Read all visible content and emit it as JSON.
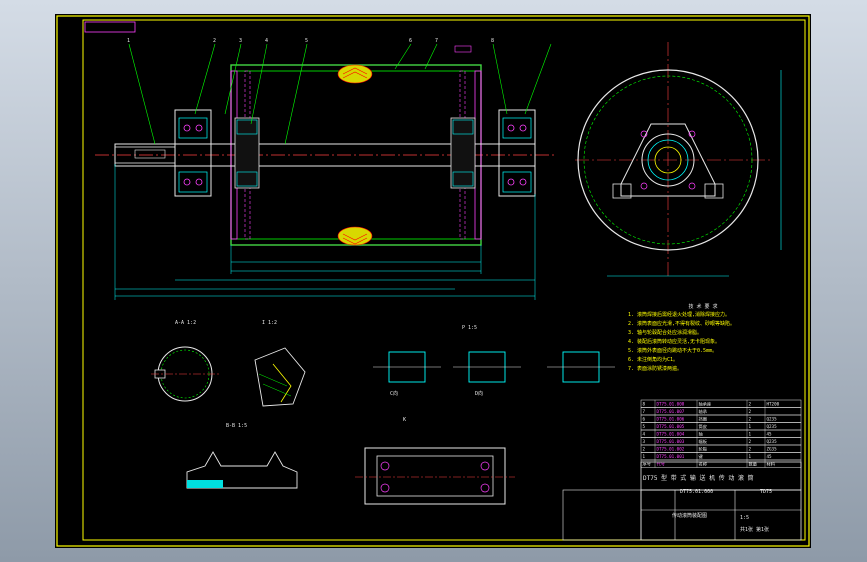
{
  "viewport": {
    "background": "#000000",
    "frame_color": "#ffff00"
  },
  "section_labels": {
    "shaft_section": "A-A",
    "shaft_section_scale": "1:2",
    "detail_I": "I",
    "detail_I_scale": "1:2",
    "keyway_view": "B-B",
    "keyway_scale": "1:5",
    "bearing_view": "P",
    "bearing_scale": "1:5",
    "weld_label": "K",
    "view_c_label": "C向",
    "view_d_label": "D向"
  },
  "leader_numbers": [
    "1",
    "2",
    "3",
    "4",
    "5",
    "6",
    "7",
    "8"
  ],
  "tech_requirements": {
    "title": "技 术 要 求",
    "lines": [
      "1. 滚筒焊接后需经退火处理,消除焊接应力。",
      "2. 滚筒表面应光滑,不得有裂纹、砂眼等缺陷。",
      "3. 轴与轮毂配合处应涂润滑脂。",
      "4. 装配后滚筒转动应灵活,无卡阻现象。",
      "5. 滚筒外表面径向跳动不大于0.5mm。",
      "6. 未注倒角均为C1。",
      "7. 表面涂防锈漆两遍。"
    ]
  },
  "title_block": {
    "drawing_title": "DT75 型 带 式 输 送 机 传 动 滚 筒",
    "drawing_no": "DT75.01.000",
    "material_code": "TD75",
    "scale_cell": "1:5",
    "sheet_cell": "共1张 第1张",
    "company": "传动滚筒装配图"
  },
  "parts_list_rows": [
    [
      "8",
      "DT75.01.008",
      "轴承座",
      "2",
      "HT200"
    ],
    [
      "7",
      "DT75.01.007",
      "轴承",
      "2",
      ""
    ],
    [
      "6",
      "DT75.01.006",
      "挡圈",
      "2",
      "Q235"
    ],
    [
      "5",
      "DT75.01.005",
      "筒皮",
      "1",
      "Q235"
    ],
    [
      "4",
      "DT75.01.004",
      "轴",
      "1",
      "45"
    ],
    [
      "3",
      "DT75.01.003",
      "辐板",
      "2",
      "Q235"
    ],
    [
      "2",
      "DT75.01.002",
      "轮毂",
      "2",
      "ZG35"
    ],
    [
      "1",
      "DT75.01.001",
      "键",
      "1",
      "45"
    ]
  ],
  "parts_header": [
    "序号",
    "代号",
    "名称",
    "数量",
    "材料"
  ]
}
